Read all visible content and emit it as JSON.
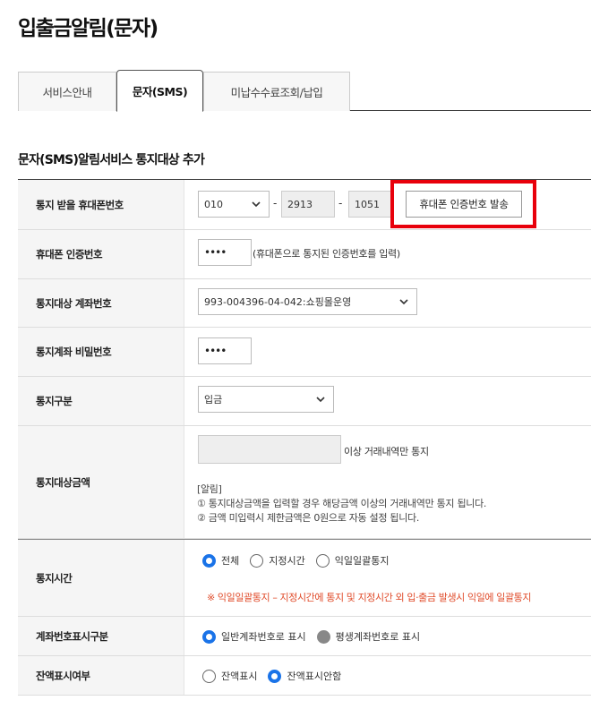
{
  "page": {
    "title": "입출금알림(문자)"
  },
  "tabs": [
    {
      "label": "서비스안내"
    },
    {
      "label": "문자(SMS)"
    },
    {
      "label": "미납수수료조회/납입"
    }
  ],
  "section": {
    "title": "문자(SMS)알림서비스 통지대상 추가"
  },
  "form": {
    "phone": {
      "label": "통지 받을 휴대폰번호",
      "prefix": "010",
      "middle": "2913",
      "last": "1051",
      "separator": "-",
      "send_button": "휴대폰 인증번호 발송"
    },
    "auth": {
      "label": "휴대폰 인증번호",
      "value": "••••",
      "hint": "(휴대폰으로 통지된 인증번호를 입력)"
    },
    "account": {
      "label": "통지대상 계좌번호",
      "value": "993-004396-04-042:쇼핑몰운영"
    },
    "password": {
      "label": "통지계좌 비밀번호",
      "value": "••••"
    },
    "type": {
      "label": "통지구분",
      "value": "입금"
    },
    "amount": {
      "label": "통지대상금액",
      "suffix": "이상 거래내역만 통지",
      "notice_title": "[알림]",
      "notice_1": "① 통지대상금액을 입력할 경우 해당금액 이상의 거래내역만 통지 됩니다.",
      "notice_2": "② 금액 미입력시 제한금액은 0원으로 자동 설정 됩니다."
    },
    "time": {
      "label": "통지시간",
      "options": [
        "전체",
        "지정시간",
        "익일일괄통지"
      ],
      "selected": "전체",
      "warning": "※ 익일일괄통지 – 지정시간에 통지 및 지정시간 외 입·출금 발생시 익일에 일괄통지"
    },
    "display": {
      "label": "계좌번호표시구분",
      "options": [
        "일반계좌번호로 표시",
        "평생계좌번호로 표시"
      ],
      "selected": "일반계좌번호로 표시"
    },
    "balance": {
      "label": "잔액표시여부",
      "options": [
        "잔액표시",
        "잔액표시안함"
      ],
      "selected": "잔액표시안함"
    }
  },
  "colors": {
    "accent": "#1a73e8",
    "highlight": "#e8000b",
    "warning": "#e04b2a"
  }
}
